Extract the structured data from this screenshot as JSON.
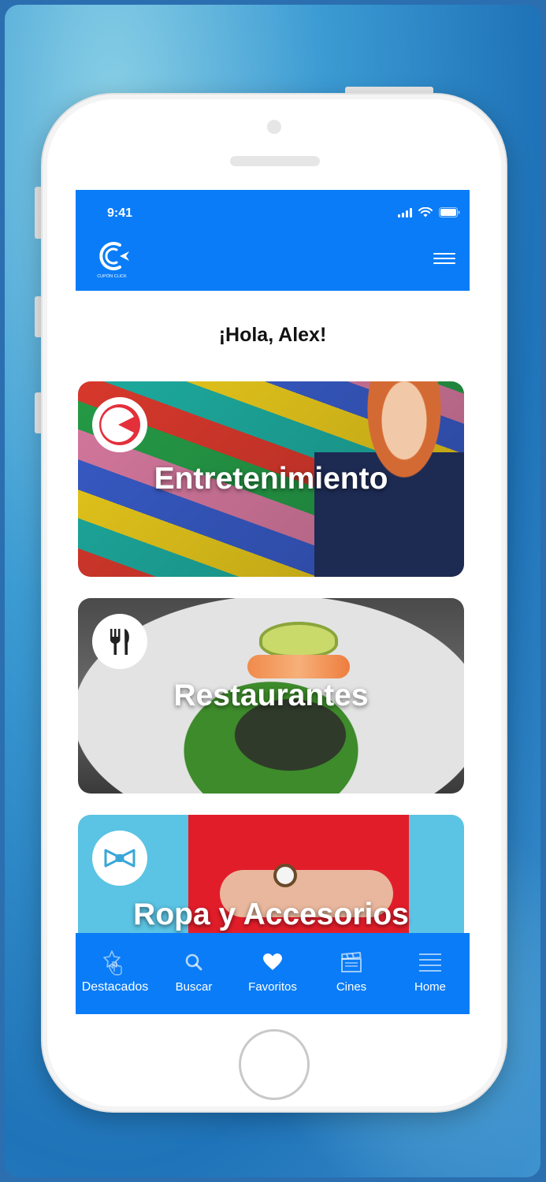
{
  "status_bar": {
    "time": "9:41"
  },
  "header": {
    "logo_text": "CUPÓN CLICK"
  },
  "greeting": "¡Hola, Alex!",
  "categories": [
    {
      "label": "Entretenimiento",
      "icon": "pacman-icon"
    },
    {
      "label": "Restaurantes",
      "icon": "fork-knife-icon"
    },
    {
      "label": "Ropa y Accesorios",
      "icon": "bowtie-icon"
    }
  ],
  "tabs": [
    {
      "label": "Destacados",
      "icon": "star-tap-icon"
    },
    {
      "label": "Buscar",
      "icon": "search-icon"
    },
    {
      "label": "Favoritos",
      "icon": "heart-icon"
    },
    {
      "label": "Cines",
      "icon": "clapperboard-icon"
    },
    {
      "label": "Home",
      "icon": "list-icon"
    }
  ],
  "colors": {
    "brand": "#0a7cf7",
    "background": "#1f73b8"
  }
}
